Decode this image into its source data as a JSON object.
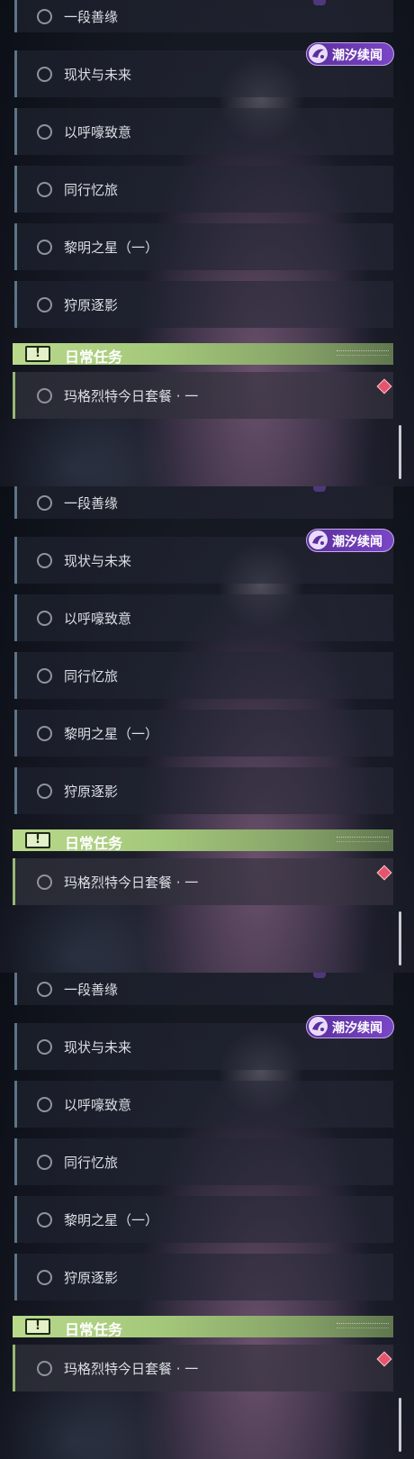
{
  "panels": [
    {
      "tasks": [
        "一段善缘",
        "现状与未来",
        "以呼嚎致意",
        "同行忆旅",
        "黎明之星（一）",
        "狩原逐影"
      ],
      "event_badge": "潮汐续闻",
      "category": {
        "icon": "!",
        "title": "日常任务"
      },
      "daily_tasks": [
        "玛格烈特今日套餐 · 一"
      ]
    },
    {
      "tasks": [
        "一段善缘",
        "现状与未来",
        "以呼嚎致意",
        "同行忆旅",
        "黎明之星（一）",
        "狩原逐影"
      ],
      "event_badge": "潮汐续闻",
      "category": {
        "icon": "!",
        "title": "日常任务"
      },
      "daily_tasks": [
        "玛格烈特今日套餐 · 一"
      ]
    },
    {
      "tasks": [
        "一段善缘",
        "现状与未来",
        "以呼嚎致意",
        "同行忆旅",
        "黎明之星（一）",
        "狩原逐影"
      ],
      "event_badge": "潮汐续闻",
      "category": {
        "icon": "!",
        "title": "日常任务"
      },
      "daily_tasks": [
        "玛格烈特今日套餐 · 一"
      ]
    }
  ],
  "icons": {
    "task_status": "empty-circle-icon",
    "event_badge": "wave-emblem-icon",
    "category": "exclamation-icon",
    "priority": "red-diamond-icon"
  },
  "colors": {
    "category_bar": "#b9d98b",
    "daily_accent": "#95b873",
    "task_accent": "#5d7488",
    "event_badge": "#7a46c6",
    "priority_marker": "#e5546c"
  }
}
